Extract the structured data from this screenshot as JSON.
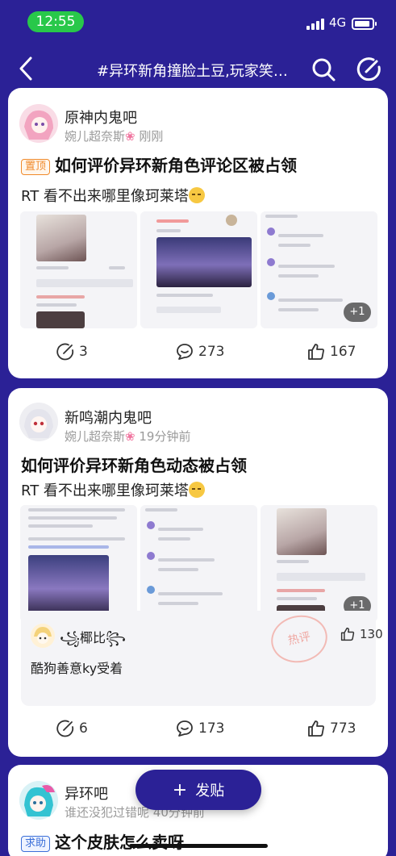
{
  "status_bar": {
    "time": "12:55",
    "network": "4G"
  },
  "nav": {
    "title": "#异环新角撞脸土豆,玩家笑嘻..."
  },
  "posts": [
    {
      "forum": "原神内鬼吧",
      "author": "婉儿超奈斯",
      "time": "刚刚",
      "tag": "置顶",
      "title": "如何评价异环新角色评论区被占领",
      "body": "RT 看不出来哪里像珂莱塔",
      "extra_images": "+1",
      "stats": {
        "comments": "3",
        "replies": "273",
        "likes": "167"
      }
    },
    {
      "forum": "新鸣潮内鬼吧",
      "author": "婉儿超奈斯",
      "time": "19分钟前",
      "title": "如何评价异环新角色动态被占领",
      "body": "RT 看不出来哪里像珂莱塔",
      "extra_images": "+1",
      "hot_comment": {
        "user": "꧁椰比꧂",
        "stamp": "热评",
        "text": "酷狗善意ky受着",
        "likes": "130"
      },
      "stats": {
        "comments": "6",
        "replies": "173",
        "likes": "773"
      }
    },
    {
      "forum": "异环吧",
      "author": "谁还没犯过错呢",
      "time": "40分钟前",
      "tag": "求助",
      "title": "这个皮肤怎么卖呀"
    }
  ],
  "fab": {
    "label": "发贴"
  },
  "colors": {
    "brand": "#2b2196",
    "top_tag": "#f08a2a",
    "help_tag": "#3b6fd8",
    "time_pill": "#28c84a"
  }
}
